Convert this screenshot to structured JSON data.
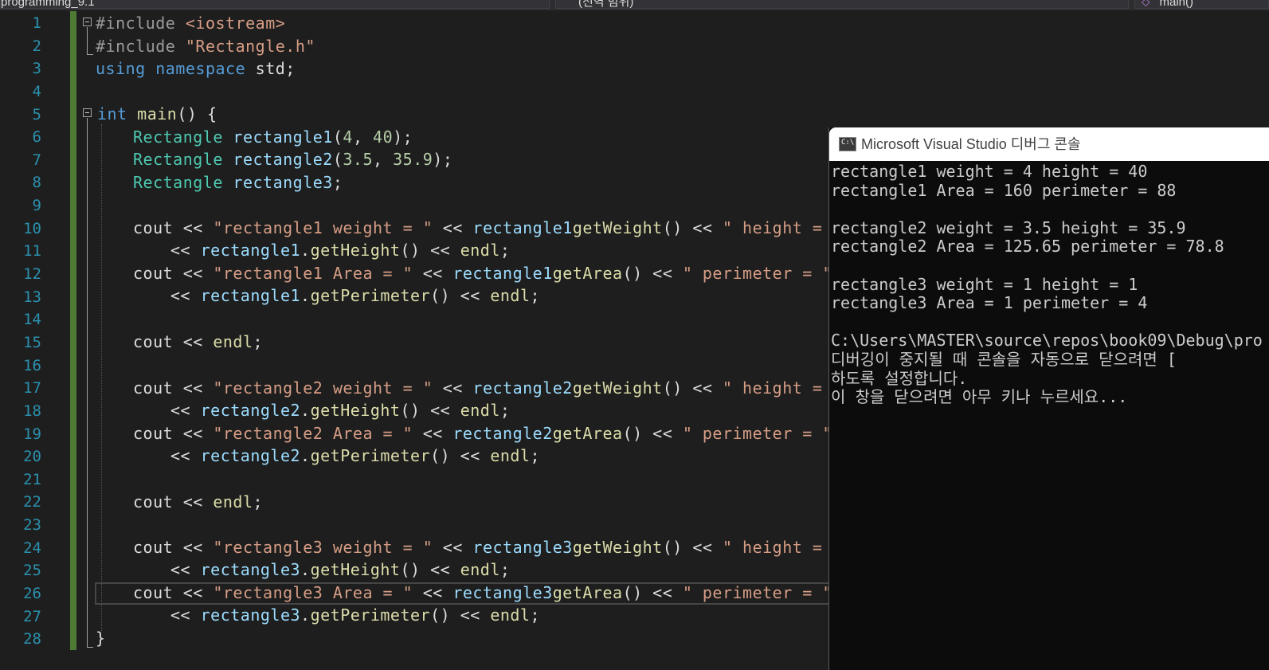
{
  "navbar": {
    "project": "programming_9.1",
    "scope": "(전역 범위)",
    "member": "main()"
  },
  "editor": {
    "line_numbers": [
      "1",
      "2",
      "3",
      "4",
      "5",
      "6",
      "7",
      "8",
      "9",
      "10",
      "11",
      "12",
      "13",
      "14",
      "15",
      "16",
      "17",
      "18",
      "19",
      "20",
      "21",
      "22",
      "23",
      "24",
      "25",
      "26",
      "27",
      "28"
    ],
    "code": {
      "l1": {
        "a": "#include ",
        "b": "<iostream>"
      },
      "l2": {
        "a": "#include ",
        "b": "\"Rectangle.h\""
      },
      "l3": {
        "a": "using",
        "b": " ",
        "c": "namespace",
        "d": " std;"
      },
      "l5": {
        "a": "int",
        "b": " ",
        "c": "main",
        "d": "() {"
      },
      "l6": {
        "a": "Rectangle",
        "b": " ",
        "c": "rectangle1",
        "d": "(",
        "e": "4",
        "f": ", ",
        "g": "40",
        "h": ");"
      },
      "l7": {
        "a": "Rectangle",
        "b": " ",
        "c": "rectangle2",
        "d": "(",
        "e": "3.5",
        "f": ", ",
        "g": "35.9",
        "h": ");"
      },
      "l8": {
        "a": "Rectangle",
        "b": " ",
        "c": "rectangle3",
        "d": ";"
      },
      "l10": {
        "a": "cout",
        " b": "",
        "c": " << ",
        "d": "\"rectangle1 weight = \"",
        "e": " << ",
        "f": "rectangle1",
        ".": ".",
        "g": "getWeight",
        "h": "() << ",
        "i": "\" height = \""
      },
      "l11": {
        "a": "<< ",
        "b": "rectangle1",
        "c": ".",
        "d": "getHeight",
        "e": "() << ",
        "f": "endl",
        "g": ";"
      },
      "l12": {
        "a": "cout",
        "c": " << ",
        "d": "\"rectangle1 Area = \"",
        "e": " << ",
        "f": "rectangle1",
        ".": ".",
        "g": "getArea",
        "h": "() << ",
        "i": "\" perimeter = \""
      },
      "l13": {
        "a": "<< ",
        "b": "rectangle1",
        "c": ".",
        "d": "getPerimeter",
        "e": "() << ",
        "f": "endl",
        "g": ";"
      },
      "l15": {
        "a": "cout",
        "c": " << ",
        "f": "endl",
        "g": ";"
      },
      "l17": {
        "a": "cout",
        "c": " << ",
        "d": "\"rectangle2 weight = \"",
        "e": " << ",
        "f": "rectangle2",
        ".": ".",
        "g": "getWeight",
        "h": "() << ",
        "i": "\" height = \""
      },
      "l18": {
        "a": "<< ",
        "b": "rectangle2",
        "c": ".",
        "d": "getHeight",
        "e": "() << ",
        "f": "endl",
        "g": ";"
      },
      "l19": {
        "a": "cout",
        "c": " << ",
        "d": "\"rectangle2 Area = \"",
        "e": " << ",
        "f": "rectangle2",
        ".": ".",
        "g": "getArea",
        "h": "() << ",
        "i": "\" perimeter = \""
      },
      "l20": {
        "a": "<< ",
        "b": "rectangle2",
        "c": ".",
        "d": "getPerimeter",
        "e": "() << ",
        "f": "endl",
        "g": ";"
      },
      "l22": {
        "a": "cout",
        "c": " << ",
        "f": "endl",
        "g": ";"
      },
      "l24": {
        "a": "cout",
        "c": " << ",
        "d": "\"rectangle3 weight = \"",
        "e": " << ",
        "f": "rectangle3",
        ".": ".",
        "g": "getWeight",
        "h": "() << ",
        "i": "\" height = \""
      },
      "l25": {
        "a": "<< ",
        "b": "rectangle3",
        "c": ".",
        "d": "getHeight",
        "e": "() << ",
        "f": "endl",
        "g": ";"
      },
      "l26": {
        "a": "cout",
        "c": " << ",
        "d": "\"rectangle3 Area = \"",
        "e": " << ",
        "f": "rectangle3",
        ".": ".",
        "g": "getArea",
        "h": "() << ",
        "i": "\" perimeter = \""
      },
      "l27": {
        "a": "<< ",
        "b": "rectangle3",
        "c": ".",
        "d": "getPerimeter",
        "e": "() << ",
        "f": "endl",
        "g": ";"
      },
      "l28": {
        "a": "}"
      }
    }
  },
  "console": {
    "title": "Microsoft Visual Studio 디버그 콘솔",
    "icon_text": "C:\\",
    "lines": [
      "rectangle1 weight = 4 height = 40",
      "rectangle1 Area = 160 perimeter = 88",
      "",
      "rectangle2 weight = 3.5 height = 35.9",
      "rectangle2 Area = 125.65 perimeter = 78.8",
      "",
      "rectangle3 weight = 1 height = 1",
      "rectangle3 Area = 1 perimeter = 4",
      "",
      "C:\\Users\\MASTER\\source\\repos\\book09\\Debug\\pro",
      "디버깅이 중지될 때 콘솔을 자동으로 닫으려면 [",
      "하도록 설정합니다.",
      "이 창을 닫으려면 아무 키나 누르세요..."
    ]
  },
  "colors": {
    "background": "#1e1e1e",
    "keyword": "#569cd6",
    "type": "#4ec9b0",
    "function": "#dcdcaa",
    "variable": "#9cdcfe",
    "string": "#d69d85",
    "number": "#b5cea8",
    "line_number": "#2b91af",
    "change_bar": "#4e7a34"
  }
}
